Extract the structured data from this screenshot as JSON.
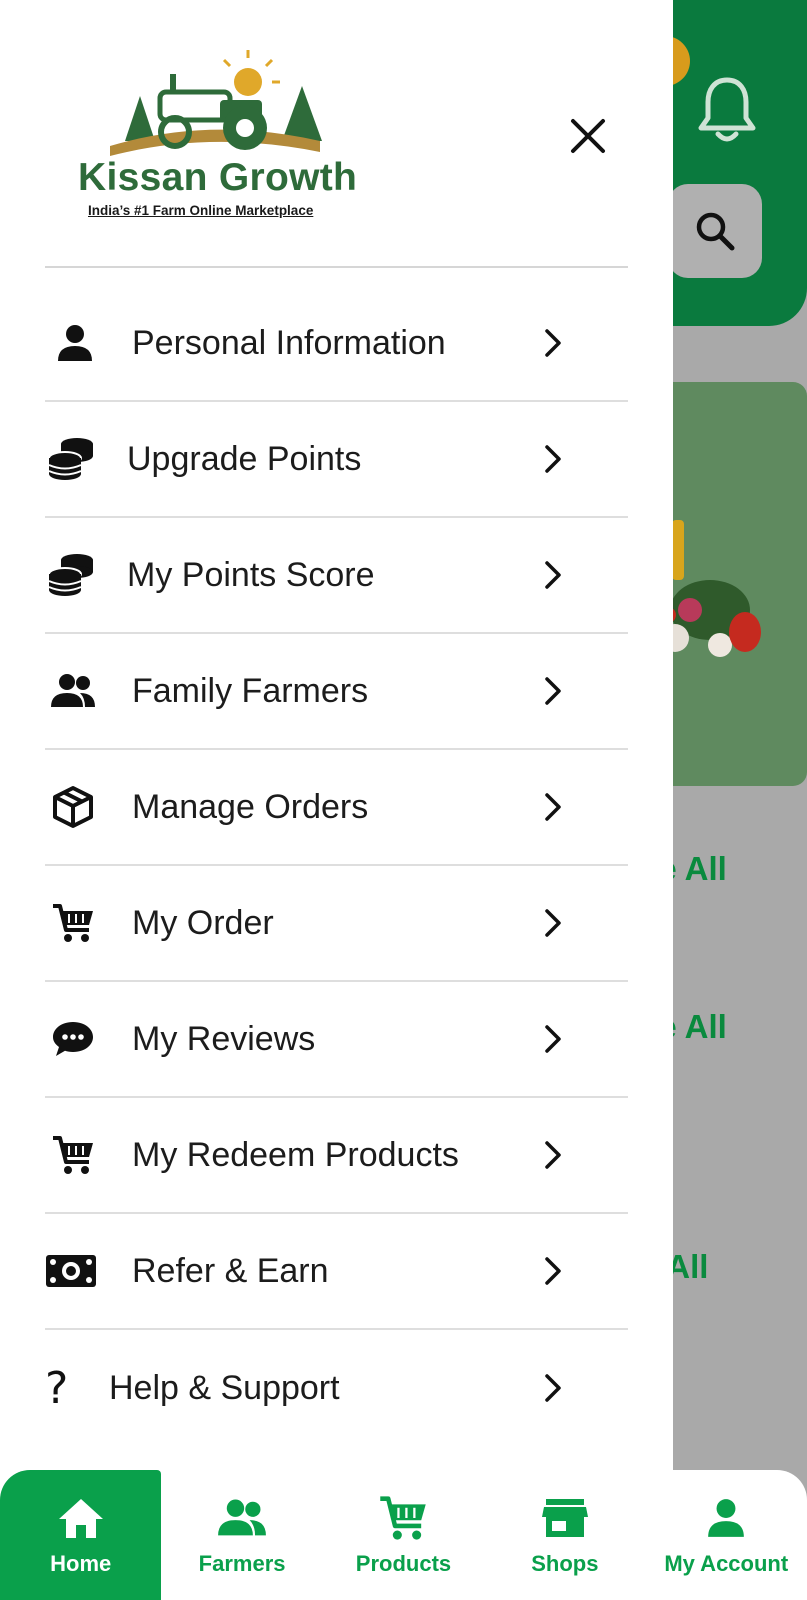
{
  "app": {
    "brand_name": "Kissan Growth",
    "tagline": "India’s #1 Farm Online Marketplace"
  },
  "colors": {
    "brand_green": "#0aa04b",
    "header_green": "#0a7a3e",
    "logo_green": "#2e6b3a"
  },
  "background": {
    "see_all_1": "ee All",
    "see_all_2": "ee All",
    "see_all_3": "e All"
  },
  "drawer": {
    "menu": [
      {
        "label": "Personal Information",
        "icon": "person-icon"
      },
      {
        "label": "Upgrade Points",
        "icon": "coins-icon"
      },
      {
        "label": "My Points Score",
        "icon": "coins-icon"
      },
      {
        "label": "Family Farmers",
        "icon": "group-icon"
      },
      {
        "label": "Manage Orders",
        "icon": "box-icon"
      },
      {
        "label": "My Order",
        "icon": "cart-icon"
      },
      {
        "label": "My Reviews",
        "icon": "chat-bubble-icon"
      },
      {
        "label": "My Redeem Products",
        "icon": "cart-icon"
      },
      {
        "label": "Refer & Earn",
        "icon": "money-icon"
      },
      {
        "label": "Help & Support",
        "icon": "question-icon"
      }
    ]
  },
  "bottom_nav": {
    "items": [
      {
        "label": "Home",
        "icon": "home-icon",
        "active": true
      },
      {
        "label": "Farmers",
        "icon": "group-icon",
        "active": false
      },
      {
        "label": "Products",
        "icon": "cart-icon",
        "active": false
      },
      {
        "label": "Shops",
        "icon": "shop-icon",
        "active": false
      },
      {
        "label": "My Account",
        "icon": "person-icon",
        "active": false
      }
    ]
  }
}
